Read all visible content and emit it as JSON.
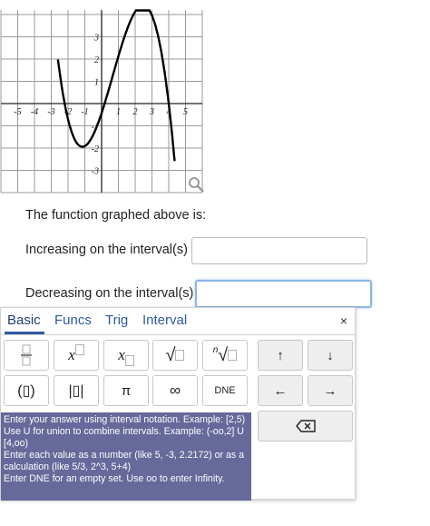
{
  "graph": {
    "x_tick_labels": [
      "-5",
      "-4",
      "-3",
      "-2",
      "-1",
      "1",
      "2",
      "3",
      "4",
      "5"
    ],
    "y_tick_labels": [
      "3",
      "2",
      "1",
      "-1",
      "-2",
      "-3"
    ],
    "x_range": [
      -6,
      6
    ],
    "y_range": [
      -4,
      4.2
    ],
    "grid": true,
    "curve_color": "#000000",
    "zoom_icon": "magnifier-icon"
  },
  "question": {
    "statement": "The function graphed above is:",
    "increasing_label": "Increasing on the interval(s)",
    "decreasing_label": "Decreasing on the interval(s)",
    "increasing_value": "",
    "decreasing_value": ""
  },
  "keypad": {
    "tabs": [
      "Basic",
      "Funcs",
      "Trig",
      "Interval"
    ],
    "close_label": "×",
    "keys": {
      "fraction": "fraction-icon",
      "power": "x",
      "subscript": "x",
      "sqrt": "√",
      "nthroot_index": "n",
      "nthroot": "√",
      "up": "↑",
      "down": "↓",
      "parens": "(▯)",
      "abs": "|▯|",
      "pi": "π",
      "infinity": "∞",
      "dne": "DNE",
      "left": "←",
      "right": "→",
      "backspace": "backspace-icon"
    },
    "info_lines": [
      "Enter your answer using interval notation. Example: [2,5)",
      "Use U for union to combine intervals. Example: (-oo,2] U [4,oo)",
      "Enter each value as a number (like 5, -3, 2.2172) or as a calculation (like 5/3, 2^3, 5+4)",
      "Enter DNE for an empty set. Use oo to enter Infinity."
    ],
    "info_bg": "#66699a"
  }
}
